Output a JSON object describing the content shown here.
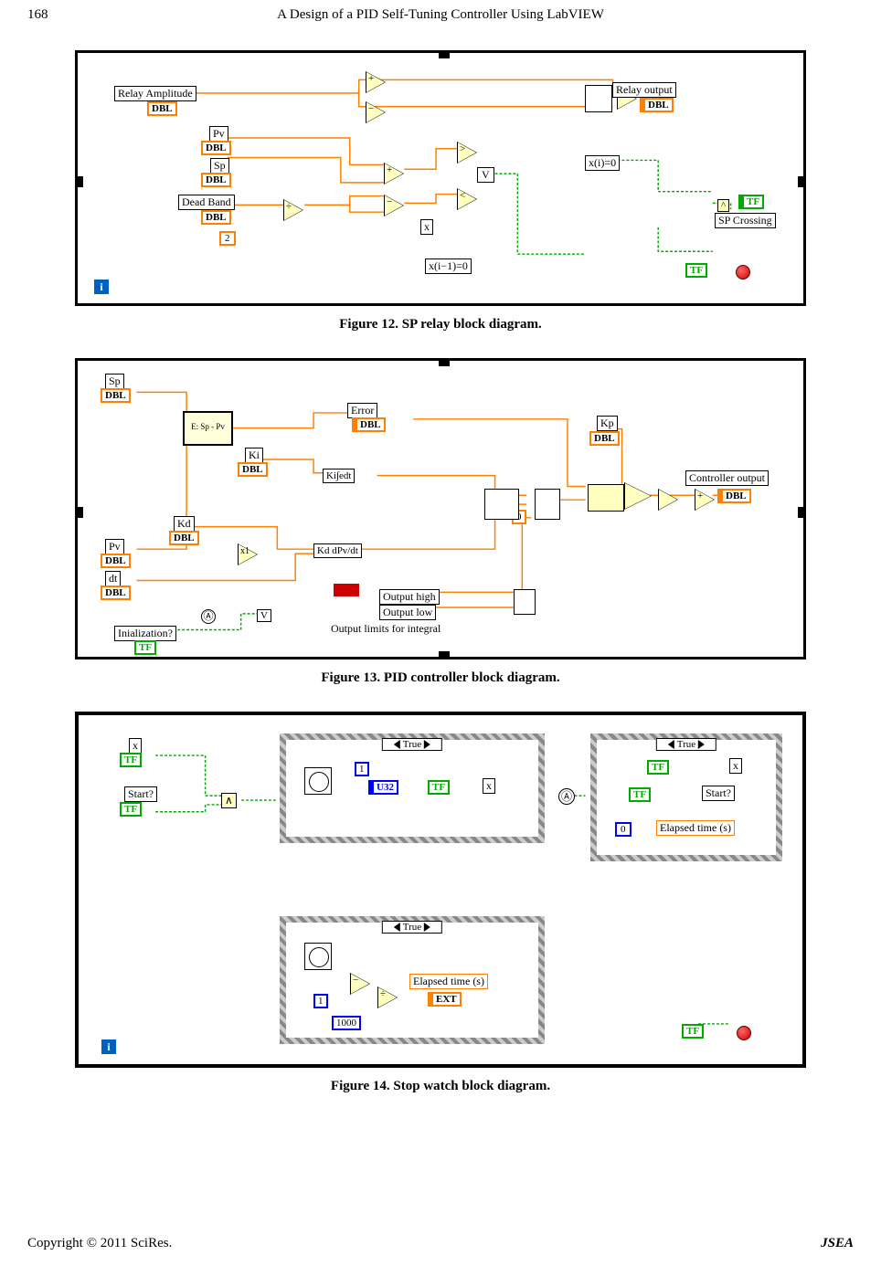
{
  "page_number": "168",
  "title": "A Design of a PID Self-Tuning Controller Using LabVIEW",
  "captions": {
    "fig12": "Figure 12. SP relay block diagram.",
    "fig13": "Figure 13. PID controller block diagram.",
    "fig14": "Figure 14. Stop watch block diagram."
  },
  "footer": {
    "copyright": "Copyright © 2011 SciRes.",
    "journal": "JSEA"
  },
  "fig12": {
    "labels": {
      "relay_amplitude": "Relay Amplitude",
      "pv": "Pv",
      "sp": "Sp",
      "dead_band": "Dead Band",
      "two": "2",
      "relay_output": "Relay output",
      "xi0": "x(i)=0",
      "xi10": "x(i−1)=0",
      "sp_crossing": "SP Crossing",
      "x": "x",
      "v": "V",
      "dbl": "DBL",
      "tf": "TF",
      "i": "i"
    },
    "ops": {
      "plus": "+",
      "minus": "−",
      "gt": ">",
      "lt": "<",
      "div": "÷",
      "caret": "^"
    }
  },
  "fig13": {
    "labels": {
      "sp": "Sp",
      "pv": "Pv",
      "dt": "dt",
      "ki": "Ki",
      "kd": "Kd",
      "kp": "Kp",
      "error": "Error",
      "esppp": "E: Sp - Pv",
      "ki_int": "Ki∫edt",
      "kd_dpv": "Kd dPv/dt",
      "output_high": "Output high",
      "output_low": "Output low",
      "output_limits": "Output limits for integral",
      "controller_output": "Controller output",
      "init": "Inialization?",
      "zero": "0",
      "dbl": "DBL",
      "tf": "TF"
    },
    "ops": {
      "plus": "+",
      "x1": "x1",
      "v": "V",
      "clock": "Ⓐ"
    }
  },
  "fig14": {
    "labels": {
      "x": "x",
      "start": "Start?",
      "true": "True",
      "one": "1",
      "one_thousand": "1000",
      "zero": "0",
      "elapsed": "Elapsed time (s)",
      "ext": "EXT",
      "u32": "U32",
      "tf": "TF",
      "i": "i"
    },
    "ops": {
      "and": "∧",
      "div": "÷",
      "sub": "−",
      "clock": "Ⓐ"
    }
  }
}
